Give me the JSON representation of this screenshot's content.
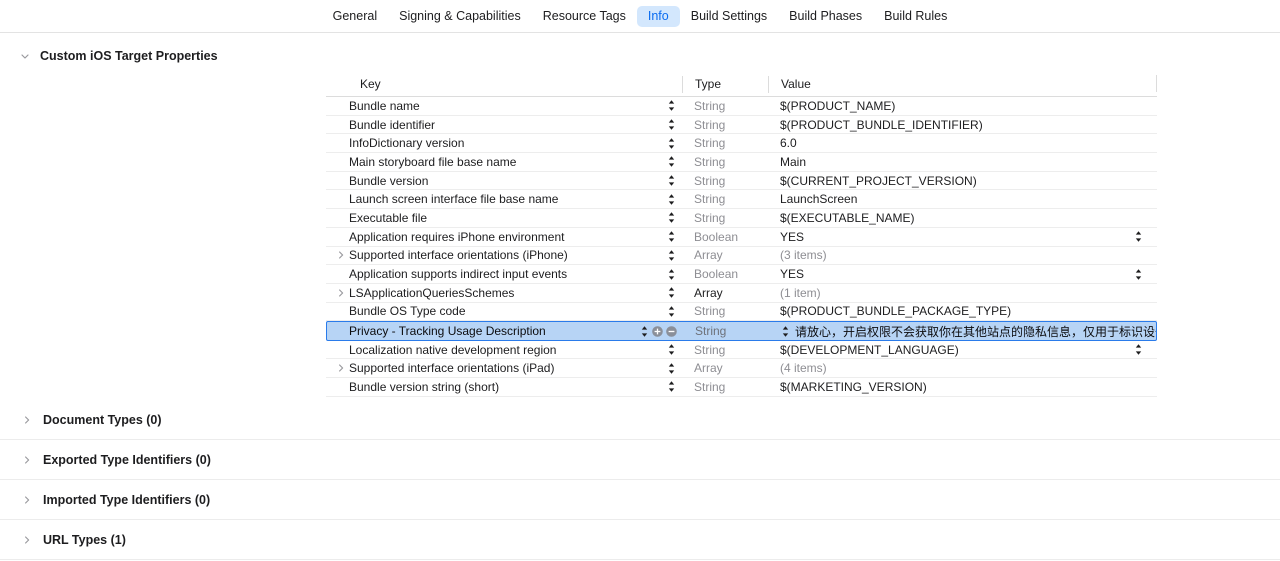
{
  "tabs": [
    {
      "label": "General",
      "selected": false
    },
    {
      "label": "Signing & Capabilities",
      "selected": false
    },
    {
      "label": "Resource Tags",
      "selected": false
    },
    {
      "label": "Info",
      "selected": true
    },
    {
      "label": "Build Settings",
      "selected": false
    },
    {
      "label": "Build Phases",
      "selected": false
    },
    {
      "label": "Build Rules",
      "selected": false
    }
  ],
  "colors": {
    "tab_selected_bg": "#d3e7fd",
    "tab_selected_text": "#0a6cf1",
    "row_selected_bg": "#b7d4f5",
    "row_selected_border": "#2a7bea",
    "muted_text": "#8e8e93"
  },
  "main_section": {
    "title": "Custom iOS Target Properties",
    "expanded": true,
    "disclosure_icon": "chevron-down-icon"
  },
  "table": {
    "headers": {
      "key": "Key",
      "type": "Type",
      "value": "Value"
    },
    "rows": [
      {
        "key": "Bundle name",
        "type": "String",
        "type_strong": false,
        "value": "$(PRODUCT_NAME)",
        "value_muted": false,
        "expandable": false,
        "selected": false,
        "end_stepper": false
      },
      {
        "key": "Bundle identifier",
        "type": "String",
        "type_strong": false,
        "value": "$(PRODUCT_BUNDLE_IDENTIFIER)",
        "value_muted": false,
        "expandable": false,
        "selected": false,
        "end_stepper": false
      },
      {
        "key": "InfoDictionary version",
        "type": "String",
        "type_strong": false,
        "value": "6.0",
        "value_muted": false,
        "expandable": false,
        "selected": false,
        "end_stepper": false
      },
      {
        "key": "Main storyboard file base name",
        "type": "String",
        "type_strong": false,
        "value": "Main",
        "value_muted": false,
        "expandable": false,
        "selected": false,
        "end_stepper": false
      },
      {
        "key": "Bundle version",
        "type": "String",
        "type_strong": false,
        "value": "$(CURRENT_PROJECT_VERSION)",
        "value_muted": false,
        "expandable": false,
        "selected": false,
        "end_stepper": false
      },
      {
        "key": "Launch screen interface file base name",
        "type": "String",
        "type_strong": false,
        "value": "LaunchScreen",
        "value_muted": false,
        "expandable": false,
        "selected": false,
        "end_stepper": false
      },
      {
        "key": "Executable file",
        "type": "String",
        "type_strong": false,
        "value": "$(EXECUTABLE_NAME)",
        "value_muted": false,
        "expandable": false,
        "selected": false,
        "end_stepper": false
      },
      {
        "key": "Application requires iPhone environment",
        "type": "Boolean",
        "type_strong": false,
        "value": "YES",
        "value_muted": false,
        "expandable": false,
        "selected": false,
        "end_stepper": true
      },
      {
        "key": "Supported interface orientations (iPhone)",
        "type": "Array",
        "type_strong": false,
        "value": "(3 items)",
        "value_muted": true,
        "expandable": true,
        "selected": false,
        "end_stepper": false
      },
      {
        "key": "Application supports indirect input events",
        "type": "Boolean",
        "type_strong": false,
        "value": "YES",
        "value_muted": false,
        "expandable": false,
        "selected": false,
        "end_stepper": true
      },
      {
        "key": "LSApplicationQueriesSchemes",
        "type": "Array",
        "type_strong": true,
        "value": "(1 item)",
        "value_muted": true,
        "expandable": true,
        "selected": false,
        "end_stepper": false
      },
      {
        "key": "Bundle OS Type code",
        "type": "String",
        "type_strong": false,
        "value": "$(PRODUCT_BUNDLE_PACKAGE_TYPE)",
        "value_muted": false,
        "expandable": false,
        "selected": false,
        "end_stepper": false
      },
      {
        "key": "Privacy - Tracking Usage Description",
        "type": "String",
        "type_strong": false,
        "value": "请放心，开启权限不会获取你在其他站点的隐私信息，仅用于标识设备并",
        "value_muted": false,
        "expandable": false,
        "selected": true,
        "end_stepper": false
      },
      {
        "key": "Localization native development region",
        "type": "String",
        "type_strong": false,
        "value": "$(DEVELOPMENT_LANGUAGE)",
        "value_muted": false,
        "expandable": false,
        "selected": false,
        "end_stepper": true
      },
      {
        "key": "Supported interface orientations (iPad)",
        "type": "Array",
        "type_strong": false,
        "value": "(4 items)",
        "value_muted": true,
        "expandable": true,
        "selected": false,
        "end_stepper": false
      },
      {
        "key": "Bundle version string (short)",
        "type": "String",
        "type_strong": false,
        "value": "$(MARKETING_VERSION)",
        "value_muted": false,
        "expandable": false,
        "selected": false,
        "end_stepper": false
      }
    ]
  },
  "collapsed_sections": [
    {
      "title": "Document Types (0)",
      "disclosure_icon": "chevron-right-icon"
    },
    {
      "title": "Exported Type Identifiers (0)",
      "disclosure_icon": "chevron-right-icon"
    },
    {
      "title": "Imported Type Identifiers (0)",
      "disclosure_icon": "chevron-right-icon"
    },
    {
      "title": "URL Types (1)",
      "disclosure_icon": "chevron-right-icon"
    }
  ]
}
